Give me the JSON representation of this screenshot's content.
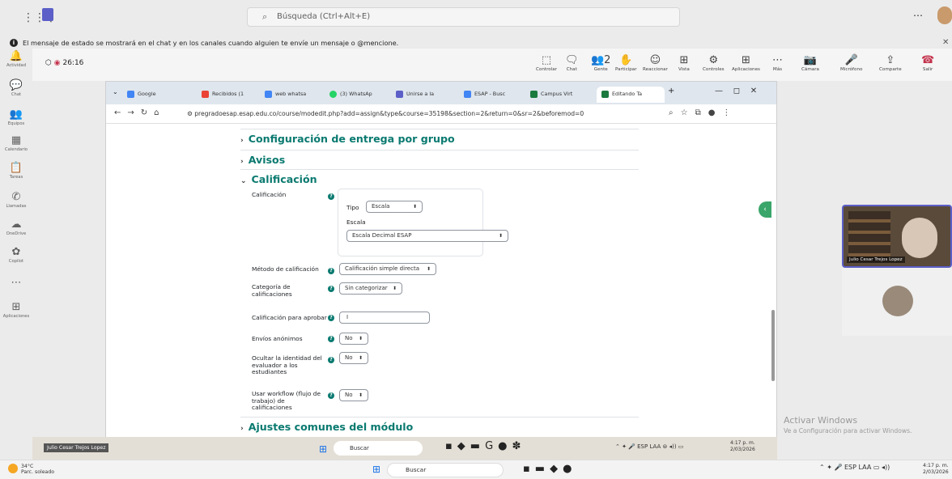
{
  "teams": {
    "search_placeholder": "Búsqueda (Ctrl+Alt+E)",
    "notice": "El mensaje de estado se mostrará en el chat y en los canales cuando alguien te envíe un mensaje o @mencione.",
    "rail": [
      {
        "label": "Actividad",
        "icon": "bell-icon",
        "glyph": "🔔"
      },
      {
        "label": "Chat",
        "icon": "chat-icon",
        "glyph": "💬"
      },
      {
        "label": "Equipos",
        "icon": "teams-icon",
        "glyph": "👥"
      },
      {
        "label": "Calendario",
        "icon": "calendar-icon",
        "glyph": "▦"
      },
      {
        "label": "Tareas",
        "icon": "clipboard-icon",
        "glyph": "📋"
      },
      {
        "label": "Llamadas",
        "icon": "phone-icon",
        "glyph": "✆"
      },
      {
        "label": "OneDrive",
        "icon": "cloud-icon",
        "glyph": "☁"
      },
      {
        "label": "Copilot",
        "icon": "copilot-icon",
        "glyph": "✿"
      },
      {
        "label": "",
        "icon": "more-icon",
        "glyph": "⋯"
      },
      {
        "label": "Aplicaciones",
        "icon": "apps-icon",
        "glyph": "⊞"
      }
    ],
    "timer": "26:16",
    "controls": [
      {
        "label": "Controlar",
        "glyph": "⬚"
      },
      {
        "label": "Chat",
        "glyph": "🗨"
      },
      {
        "label": "Gente",
        "glyph": "👥2"
      },
      {
        "label": "Participar",
        "glyph": "✋"
      },
      {
        "label": "Reaccionar",
        "glyph": "☺"
      },
      {
        "label": "Vista",
        "glyph": "⊞"
      },
      {
        "label": "Controles",
        "glyph": "⚙"
      },
      {
        "label": "Aplicaciones",
        "glyph": "⊞"
      },
      {
        "label": "Más",
        "glyph": "⋯"
      },
      {
        "label": "Cámara",
        "glyph": "📷"
      },
      {
        "label": "Micrófono",
        "glyph": "🎤"
      },
      {
        "label": "Comparte",
        "glyph": "⇪"
      },
      {
        "label": "Salir",
        "glyph": "☎"
      }
    ]
  },
  "browser": {
    "tabs": [
      {
        "label": "Google",
        "color": "#4285f4"
      },
      {
        "label": "Recibidos (1",
        "color": "#ea4335"
      },
      {
        "label": "web whatsa",
        "color": "#4285f4"
      },
      {
        "label": "(3) WhatsAp",
        "color": "#25d366"
      },
      {
        "label": "Unirse a la",
        "color": "#5b5fc7"
      },
      {
        "label": "ESAP - Busc",
        "color": "#4285f4"
      },
      {
        "label": "Campus Virt",
        "color": "#1b7a3e"
      },
      {
        "label": "Editando Ta",
        "color": "#1b7a3e"
      }
    ],
    "url": "pregradoesap.esap.edu.co/course/modedit.php?add=assign&type&course=35198&section=2&return=0&sr=2&beforemod=0"
  },
  "form": {
    "sections": {
      "group": "Configuración de entrega por grupo",
      "avisos": "Avisos",
      "calificacion": "Calificación",
      "ajustes": "Ajustes comunes del módulo"
    },
    "grade_label": "Calificación",
    "tipo_label": "Tipo",
    "tipo_value": "Escala",
    "escala_label": "Escala",
    "escala_value": "Escala Decimal ESAP",
    "metodo_label": "Método de calificación",
    "metodo_value": "Calificación simple directa",
    "categoria_label": "Categoría de calificaciones",
    "categoria_value": "Sin categorizar",
    "aprobar_label": "Calificación para aprobar",
    "aprobar_value": "",
    "anonimos_label": "Envíos anónimos",
    "anonimos_value": "No",
    "ocultar_label": "Ocultar la identidad del evaluador a los estudiantes",
    "ocultar_value": "No",
    "workflow_label": "Usar workflow (flujo de trabajo) de calificaciones",
    "workflow_value": "No"
  },
  "video": {
    "participant": "Julio Cesar Trejos Lopez"
  },
  "activate": {
    "title": "Activar Windows",
    "subtitle": "Ve a Configuración para activar Windows."
  },
  "inner_taskbar": {
    "presenter": "Julio Cesar Trejos Lopez",
    "search": "Buscar",
    "lang": "ESP LAA",
    "time": "4:17 p. m.",
    "date": "2/03/2026"
  },
  "host_taskbar": {
    "temp": "34°C",
    "weather": "Parc. soleado",
    "search": "Buscar",
    "lang": "ESP LAA",
    "time": "4:17 p. m.",
    "date": "2/03/2026"
  }
}
